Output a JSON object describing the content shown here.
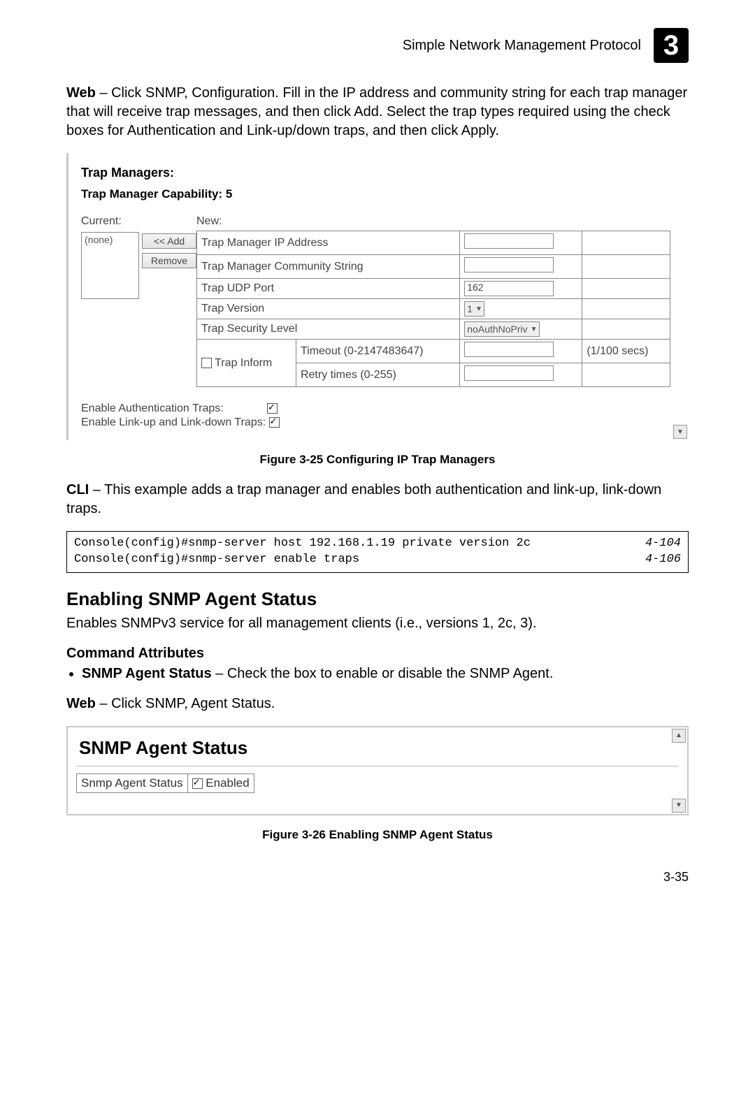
{
  "header": {
    "title": "Simple Network Management Protocol",
    "chapter": "3"
  },
  "intro": {
    "lead": "Web",
    "rest": " – Click SNMP, Configuration. Fill in the IP address and community string for each trap manager that will receive trap messages, and then click Add. Select the trap types required using the check boxes for Authentication and Link-up/down traps, and then click Apply."
  },
  "trap": {
    "title": "Trap Managers:",
    "capability_label": "Trap Manager Capability: 5",
    "current_label": "Current:",
    "current_value": "(none)",
    "add_btn": "<< Add",
    "remove_btn": "Remove",
    "new_label": "New:",
    "rows": {
      "ip": "Trap Manager IP Address",
      "community": "Trap Manager Community String",
      "udp": "Trap UDP Port",
      "udp_val": "162",
      "version": "Trap Version",
      "version_val": "1",
      "security": "Trap Security Level",
      "security_val": "noAuthNoPriv",
      "inform": "Trap Inform",
      "timeout": "Timeout (0-2147483647)",
      "timeout_unit": "(1/100 secs)",
      "retry": "Retry times (0-255)"
    },
    "enable_auth": "Enable Authentication Traps:",
    "enable_link": "Enable Link-up and Link-down Traps:"
  },
  "fig1": "Figure 3-25  Configuring IP Trap Managers",
  "cli_intro": {
    "lead": "CLI",
    "rest": " – This example adds a trap manager and enables both authentication and link-up, link-down traps."
  },
  "cli": {
    "line1": "Console(config)#snmp-server host 192.168.1.19 private version 2c",
    "ref1": "4-104",
    "line2": "Console(config)#snmp-server enable traps",
    "ref2": "4-106"
  },
  "section2": {
    "title": "Enabling SNMP Agent Status",
    "desc": "Enables SNMPv3 service for all management clients (i.e., versions 1, 2c, 3).",
    "cmd_attr": "Command Attributes",
    "bullet_lead": "SNMP Agent Status",
    "bullet_rest": " – Check the box to enable or disable the SNMP Agent.",
    "web_lead": "Web",
    "web_rest": " – Click SNMP, Agent Status."
  },
  "status": {
    "title": "SNMP Agent Status",
    "cell_label": "Snmp Agent Status",
    "cell_value": "Enabled"
  },
  "fig2": "Figure 3-26  Enabling SNMP Agent Status",
  "page_num": "3-35"
}
